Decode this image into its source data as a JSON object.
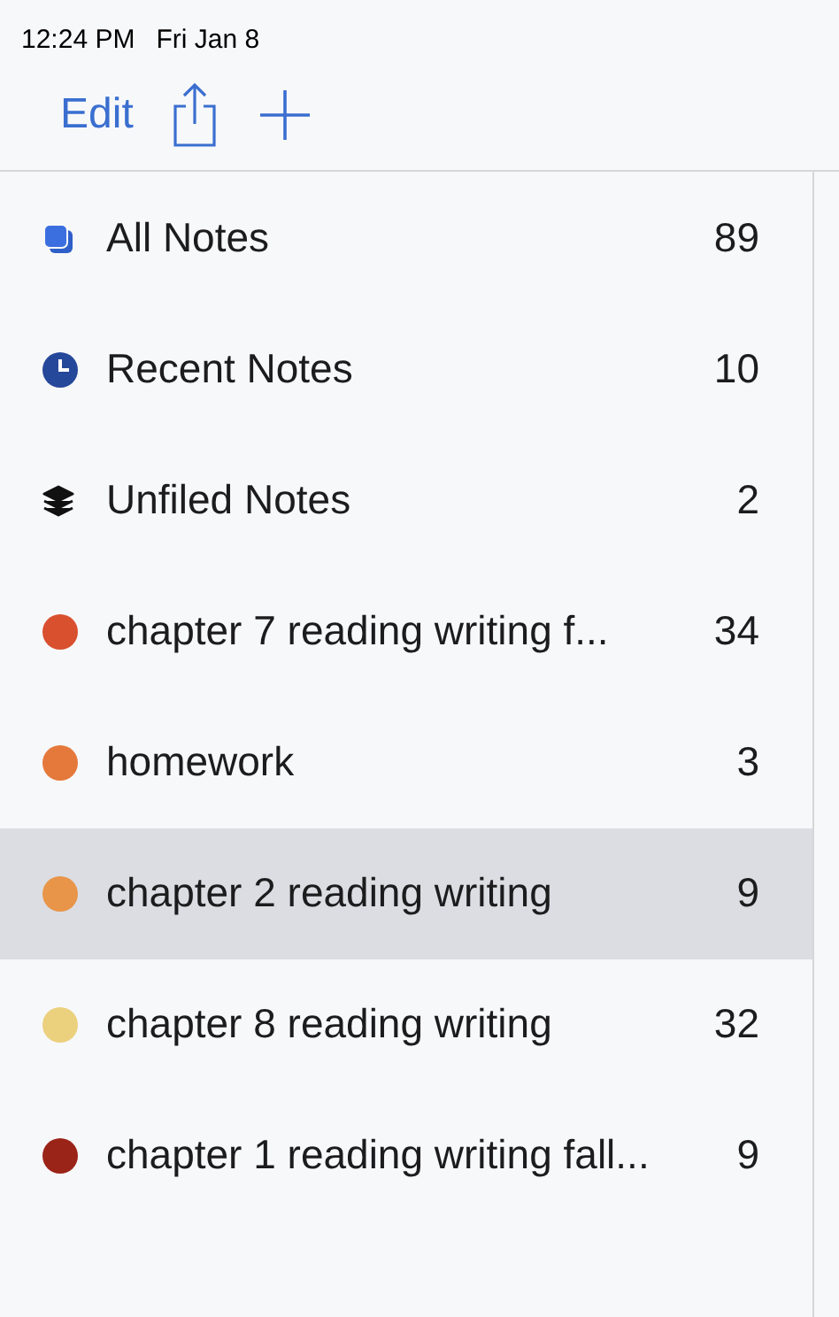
{
  "status_bar": {
    "time": "12:24 PM",
    "date": "Fri Jan 8"
  },
  "toolbar": {
    "edit": "Edit"
  },
  "items": [
    {
      "kind": "all",
      "label": "All Notes",
      "count": "89",
      "selected": false
    },
    {
      "kind": "recent",
      "label": "Recent Notes",
      "count": "10",
      "selected": false
    },
    {
      "kind": "unfiled",
      "label": "Unfiled Notes",
      "count": "2",
      "selected": false
    },
    {
      "kind": "notebook",
      "label": "chapter 7 reading writing f...",
      "count": "34",
      "selected": false,
      "color": "#d9502f"
    },
    {
      "kind": "notebook",
      "label": "homework",
      "count": "3",
      "selected": false,
      "color": "#e5793b"
    },
    {
      "kind": "notebook",
      "label": "chapter 2 reading writing",
      "count": "9",
      "selected": true,
      "color": "#e8954a"
    },
    {
      "kind": "notebook",
      "label": "chapter 8 reading writing",
      "count": "32",
      "selected": false,
      "color": "#ebd07e"
    },
    {
      "kind": "notebook",
      "label": "chapter 1 reading writing fall...",
      "count": "9",
      "selected": false,
      "color": "#9b2418"
    }
  ]
}
